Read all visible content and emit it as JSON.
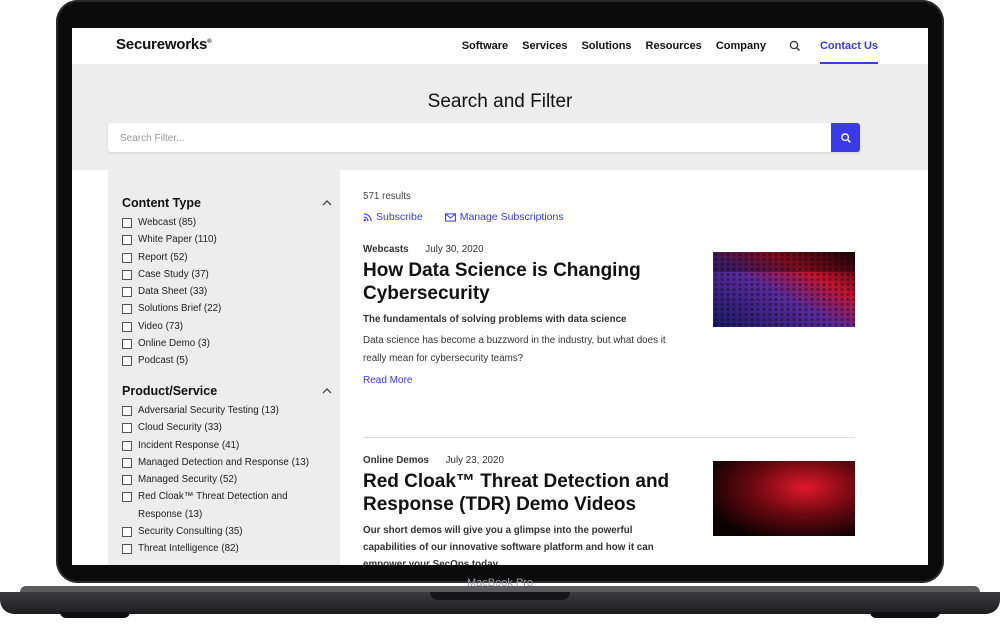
{
  "header": {
    "logo": "Secureworks",
    "nav": [
      "Software",
      "Services",
      "Solutions",
      "Resources",
      "Company"
    ],
    "contact": "Contact Us"
  },
  "hero": {
    "title": "Search and Filter",
    "search_placeholder": "Search Filter..."
  },
  "sidebar": {
    "content_type": {
      "heading": "Content Type",
      "items": [
        "Webcast (85)",
        "White Paper (110)",
        "Report (52)",
        "Case Study (37)",
        "Data Sheet (33)",
        "Solutions Brief (22)",
        "Video (73)",
        "Online Demo (3)",
        "Podcast (5)"
      ]
    },
    "product_service": {
      "heading": "Product/Service",
      "items": [
        "Adversarial Security Testing (13)",
        "Cloud Security (33)",
        "Incident Response (41)",
        "Managed Detection and Response (13)",
        "Managed Security (52)",
        "Red Cloak™ Threat Detection and Response (13)",
        "Security Consulting (35)",
        "Threat Intelligence (82)"
      ]
    }
  },
  "results": {
    "count": "571 results",
    "subscribe": "Subscribe",
    "manage": "Manage Subscriptions",
    "items": [
      {
        "type": "Webcasts",
        "date": "July 30, 2020",
        "title": "How Data Science is Changing Cybersecurity",
        "subtitle": "The fundamentals of solving problems with data science",
        "description": "Data science has become a buzzword in the industry, but what does it really mean for cybersecurity teams?",
        "read_more": "Read More"
      },
      {
        "type": "Online Demos",
        "date": "July 23, 2020",
        "title": "Red Cloak™ Threat Detection and Response (TDR) Demo Videos",
        "subtitle": "Our short demos will give you a glimpse into the powerful capabilities of our innovative software platform and how it can empower your SecOps today"
      }
    ]
  },
  "device": {
    "label": "MacBook Pro"
  },
  "colors": {
    "accent": "#3a3ae6",
    "panel": "#ededed"
  }
}
